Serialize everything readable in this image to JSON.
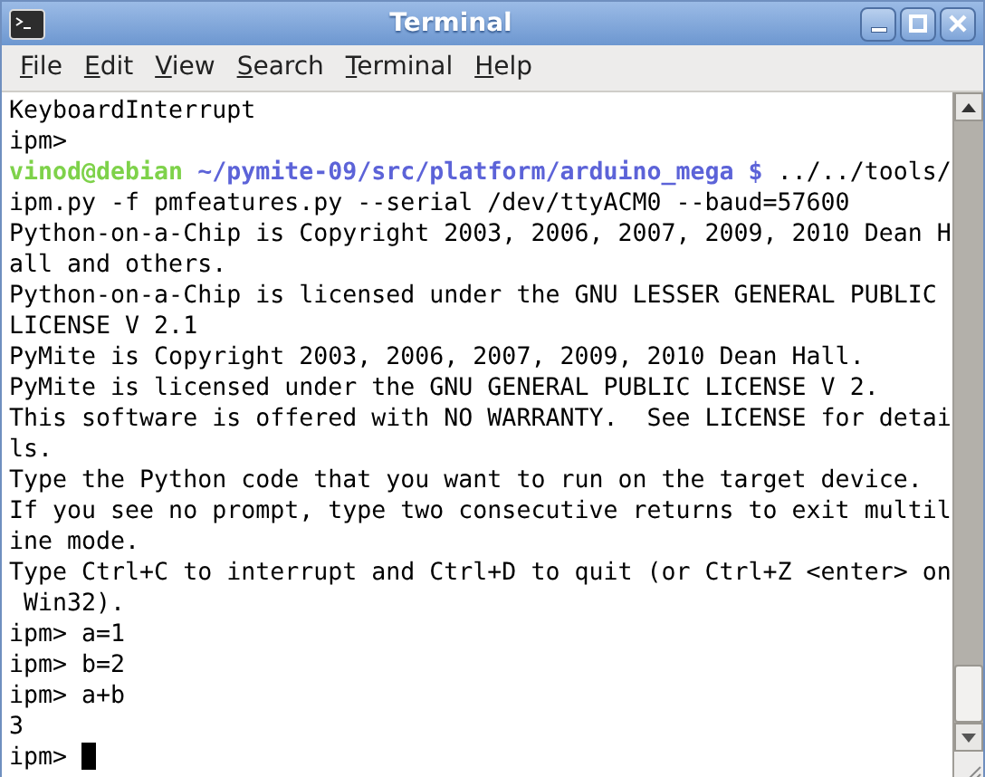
{
  "window": {
    "title": "Terminal"
  },
  "menu": [
    {
      "label": "File"
    },
    {
      "label": "Edit"
    },
    {
      "label": "View"
    },
    {
      "label": "Search"
    },
    {
      "label": "Terminal"
    },
    {
      "label": "Help"
    }
  ],
  "terminal": {
    "lines": [
      {
        "kind": "text",
        "text": "KeyboardInterrupt"
      },
      {
        "kind": "text",
        "text": "ipm>"
      },
      {
        "kind": "shell_prompt",
        "user_host": "vinod@debian",
        "path": "~/pymite-09/src/platform/arduino_mega $",
        "command": "../../tools/"
      },
      {
        "kind": "text",
        "text": "ipm.py -f pmfeatures.py --serial /dev/ttyACM0 --baud=57600"
      },
      {
        "kind": "text",
        "text": "Python-on-a-Chip is Copyright 2003, 2006, 2007, 2009, 2010 Dean H"
      },
      {
        "kind": "text",
        "text": "all and others."
      },
      {
        "kind": "text",
        "text": "Python-on-a-Chip is licensed under the GNU LESSER GENERAL PUBLIC"
      },
      {
        "kind": "text",
        "text": "LICENSE V 2.1"
      },
      {
        "kind": "text",
        "text": "PyMite is Copyright 2003, 2006, 2007, 2009, 2010 Dean Hall."
      },
      {
        "kind": "text",
        "text": "PyMite is licensed under the GNU GENERAL PUBLIC LICENSE V 2."
      },
      {
        "kind": "text",
        "text": "This software is offered with NO WARRANTY.  See LICENSE for detai"
      },
      {
        "kind": "text",
        "text": "ls."
      },
      {
        "kind": "text",
        "text": "Type the Python code that you want to run on the target device."
      },
      {
        "kind": "text",
        "text": "If you see no prompt, type two consecutive returns to exit multil"
      },
      {
        "kind": "text",
        "text": "ine mode."
      },
      {
        "kind": "text",
        "text": "Type Ctrl+C to interrupt and Ctrl+D to quit (or Ctrl+Z <enter> on"
      },
      {
        "kind": "text",
        "text": " Win32)."
      },
      {
        "kind": "text",
        "text": "ipm> a=1"
      },
      {
        "kind": "text",
        "text": "ipm> b=2"
      },
      {
        "kind": "text",
        "text": "ipm> a+b"
      },
      {
        "kind": "text",
        "text": "3"
      },
      {
        "kind": "text",
        "text": "ipm> ",
        "cursor": true
      }
    ]
  }
}
